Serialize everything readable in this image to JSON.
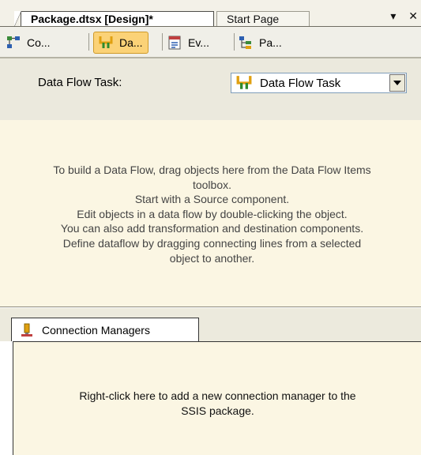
{
  "doc_tabs": {
    "active_label": "Package.dtsx [Design]*",
    "inactive_label": "Start Page",
    "menu_glyph": "▾",
    "close_glyph": "✕"
  },
  "designer_tabs": [
    {
      "label": "Co...",
      "icon": "control-flow-icon"
    },
    {
      "label": "Da...",
      "icon": "data-flow-icon",
      "selected": true
    },
    {
      "label": "Ev...",
      "icon": "event-handlers-icon"
    },
    {
      "label": "Pa...",
      "icon": "package-explorer-icon"
    }
  ],
  "task_bar": {
    "label": "Data Flow Task:",
    "selected_value": "Data Flow Task"
  },
  "design_surface": {
    "lines": [
      "To build a Data Flow, drag objects here from the Data Flow Items",
      "toolbox.",
      "Start with a Source component.",
      "Edit objects in a data flow by double-clicking the object.",
      "You can also add transformation and destination components.",
      "Define dataflow by dragging connecting lines from a selected",
      "object to another."
    ]
  },
  "connection_managers": {
    "tab_label": "Connection Managers",
    "hint_line1": "Right-click here to add a new connection manager to the",
    "hint_line2": "SSIS package."
  },
  "colors": {
    "surface_background": "#fbf6e3",
    "selected_tab": "#fbd277"
  }
}
